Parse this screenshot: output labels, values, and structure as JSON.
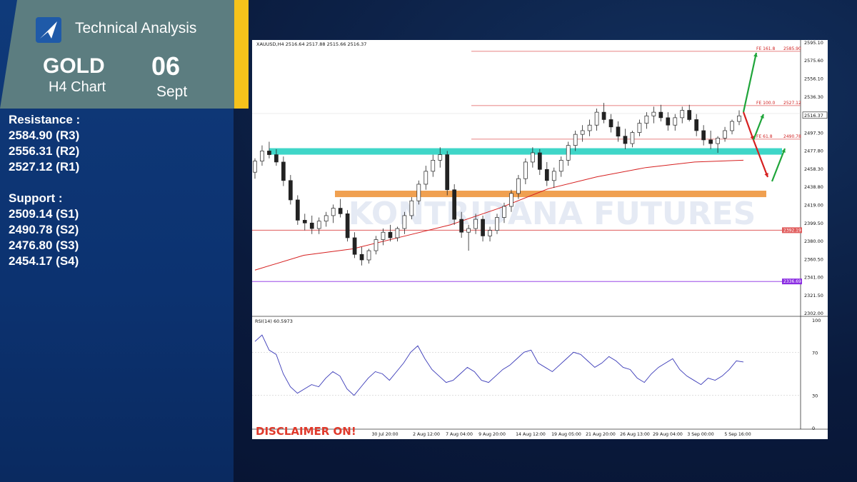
{
  "header": {
    "title": "Technical Analysis",
    "instrument": "GOLD",
    "timeframe": "H4 Chart",
    "day": "06",
    "month": "Sept"
  },
  "levels": {
    "resistance_title": "Resistance :",
    "resistance": [
      "2584.90 (R3)",
      "2556.31 (R2)",
      "2527.12 (R1)"
    ],
    "support_title": "Support :",
    "support": [
      "2509.14 (S1)",
      "2490.78 (S2)",
      "2476.80 (S3)",
      "2454.17 (S4)"
    ]
  },
  "chart_data": {
    "type": "candlestick",
    "symbol_info": "XAUUSD,H4  2516.64 2517.88 2515.66 2516.37",
    "current_price": "2516.37",
    "ylim": [
      2302.0,
      2595.1
    ],
    "y_ticks": [
      "2595.10",
      "2575.60",
      "2556.10",
      "2536.30",
      "2516.37",
      "2497.30",
      "2477.80",
      "2458.30",
      "2438.80",
      "2419.00",
      "2399.50",
      "2380.00",
      "2360.50",
      "2341.00",
      "2321.50",
      "2302.00"
    ],
    "x_ticks": [
      "30 Jul 20:00",
      "2 Aug 12:00",
      "7 Aug 04:00",
      "9 Aug 20:00",
      "14 Aug 12:00",
      "19 Aug 05:00",
      "21 Aug 20:00",
      "26 Aug 13:00",
      "29 Aug 04:00",
      "3 Sep 00:00",
      "5 Sep 16:00"
    ],
    "fib_levels": [
      {
        "label": "FE 161.8",
        "value": 2585.9,
        "value_label": "2585.90"
      },
      {
        "label": "FE 100.0",
        "value": 2527.12,
        "value_label": "2527.12"
      },
      {
        "label": "FE 61.8",
        "value": 2490.78,
        "value_label": "2490.78"
      }
    ],
    "horizontal_lines": [
      {
        "value": 2392.19,
        "value_label": "2392.19",
        "color": "#e05a5a"
      },
      {
        "value": 2336.69,
        "value_label": "2336.69",
        "color": "#8a2be2"
      }
    ],
    "zones": [
      {
        "name": "support-zone-teal",
        "low": 2474.0,
        "high": 2481.0,
        "color": "#3fd6c8"
      },
      {
        "name": "support-zone-orange",
        "low": 2428.0,
        "high": 2435.0,
        "color": "#f0a050"
      }
    ],
    "ma_line": [
      [
        0,
        2349
      ],
      [
        0.1,
        2365
      ],
      [
        0.2,
        2372
      ],
      [
        0.3,
        2385
      ],
      [
        0.4,
        2398
      ],
      [
        0.5,
        2416
      ],
      [
        0.6,
        2437
      ],
      [
        0.7,
        2450
      ],
      [
        0.8,
        2460
      ],
      [
        0.9,
        2466
      ],
      [
        1.0,
        2468
      ]
    ],
    "candles": [
      [
        2455,
        2470,
        2448,
        2467
      ],
      [
        2467,
        2484,
        2462,
        2478
      ],
      [
        2478,
        2488,
        2470,
        2474
      ],
      [
        2474,
        2480,
        2462,
        2466
      ],
      [
        2466,
        2472,
        2440,
        2446
      ],
      [
        2446,
        2452,
        2420,
        2425
      ],
      [
        2425,
        2430,
        2398,
        2403
      ],
      [
        2403,
        2410,
        2392,
        2400
      ],
      [
        2400,
        2408,
        2388,
        2394
      ],
      [
        2394,
        2406,
        2388,
        2402
      ],
      [
        2402,
        2412,
        2396,
        2408
      ],
      [
        2408,
        2420,
        2400,
        2416
      ],
      [
        2416,
        2426,
        2406,
        2410
      ],
      [
        2410,
        2414,
        2380,
        2384
      ],
      [
        2384,
        2390,
        2362,
        2366
      ],
      [
        2366,
        2374,
        2354,
        2360
      ],
      [
        2360,
        2372,
        2356,
        2370
      ],
      [
        2370,
        2386,
        2366,
        2382
      ],
      [
        2382,
        2394,
        2376,
        2390
      ],
      [
        2390,
        2398,
        2380,
        2384
      ],
      [
        2384,
        2396,
        2380,
        2394
      ],
      [
        2394,
        2412,
        2388,
        2408
      ],
      [
        2408,
        2428,
        2404,
        2424
      ],
      [
        2424,
        2446,
        2420,
        2442
      ],
      [
        2442,
        2462,
        2436,
        2456
      ],
      [
        2456,
        2474,
        2450,
        2468
      ],
      [
        2468,
        2482,
        2460,
        2474
      ],
      [
        2474,
        2478,
        2430,
        2436
      ],
      [
        2436,
        2442,
        2398,
        2404
      ],
      [
        2404,
        2412,
        2384,
        2390
      ],
      [
        2390,
        2398,
        2370,
        2394
      ],
      [
        2394,
        2410,
        2388,
        2404
      ],
      [
        2404,
        2408,
        2380,
        2386
      ],
      [
        2386,
        2396,
        2380,
        2392
      ],
      [
        2392,
        2410,
        2388,
        2406
      ],
      [
        2406,
        2422,
        2400,
        2418
      ],
      [
        2418,
        2436,
        2412,
        2432
      ],
      [
        2432,
        2452,
        2426,
        2448
      ],
      [
        2448,
        2470,
        2442,
        2466
      ],
      [
        2466,
        2482,
        2460,
        2476
      ],
      [
        2476,
        2480,
        2452,
        2458
      ],
      [
        2458,
        2466,
        2440,
        2446
      ],
      [
        2446,
        2460,
        2438,
        2456
      ],
      [
        2456,
        2472,
        2450,
        2468
      ],
      [
        2468,
        2488,
        2462,
        2484
      ],
      [
        2484,
        2500,
        2478,
        2496
      ],
      [
        2496,
        2506,
        2488,
        2500
      ],
      [
        2500,
        2512,
        2494,
        2506
      ],
      [
        2506,
        2524,
        2500,
        2520
      ],
      [
        2520,
        2530,
        2508,
        2512
      ],
      [
        2512,
        2518,
        2498,
        2504
      ],
      [
        2504,
        2510,
        2488,
        2494
      ],
      [
        2494,
        2502,
        2480,
        2486
      ],
      [
        2486,
        2500,
        2482,
        2498
      ],
      [
        2498,
        2512,
        2494,
        2508
      ],
      [
        2508,
        2520,
        2502,
        2516
      ],
      [
        2516,
        2526,
        2508,
        2520
      ],
      [
        2520,
        2528,
        2510,
        2514
      ],
      [
        2514,
        2520,
        2500,
        2506
      ],
      [
        2506,
        2518,
        2500,
        2514
      ],
      [
        2514,
        2526,
        2508,
        2522
      ],
      [
        2522,
        2528,
        2510,
        2512
      ],
      [
        2512,
        2518,
        2494,
        2500
      ],
      [
        2500,
        2506,
        2484,
        2490
      ],
      [
        2490,
        2500,
        2480,
        2486
      ],
      [
        2486,
        2494,
        2476,
        2492
      ],
      [
        2492,
        2504,
        2488,
        2500
      ],
      [
        2500,
        2512,
        2496,
        2510
      ],
      [
        2510,
        2522,
        2506,
        2516
      ]
    ],
    "rsi": {
      "label": "RSI(14) 60.5973",
      "ylim": [
        0,
        100
      ],
      "ticks": [
        "100",
        "70",
        "30",
        "0"
      ],
      "values": [
        80,
        86,
        72,
        68,
        50,
        38,
        32,
        36,
        40,
        38,
        46,
        52,
        48,
        36,
        30,
        38,
        46,
        52,
        50,
        44,
        52,
        60,
        70,
        76,
        64,
        54,
        48,
        42,
        44,
        50,
        56,
        52,
        44,
        42,
        48,
        54,
        58,
        64,
        70,
        72,
        60,
        56,
        52,
        58,
        64,
        70,
        68,
        62,
        56,
        60,
        66,
        62,
        56,
        54,
        46,
        42,
        50,
        56,
        60,
        64,
        54,
        48,
        44,
        40,
        46,
        44,
        48,
        54,
        62,
        61
      ]
    },
    "arrows": [
      {
        "name": "bullish-arrow-upper",
        "color": "#1fa53a"
      },
      {
        "name": "bearish-arrow-short",
        "color": "#d62020"
      },
      {
        "name": "bullish-arrow-mid",
        "color": "#1fa53a"
      },
      {
        "name": "bearish-arrow-long",
        "color": "#d62020"
      },
      {
        "name": "bullish-arrow-lower",
        "color": "#1fa53a"
      }
    ],
    "watermark": "KONTRIDANA FUTURES",
    "disclaimer": "DISCLAIMER ON!"
  }
}
